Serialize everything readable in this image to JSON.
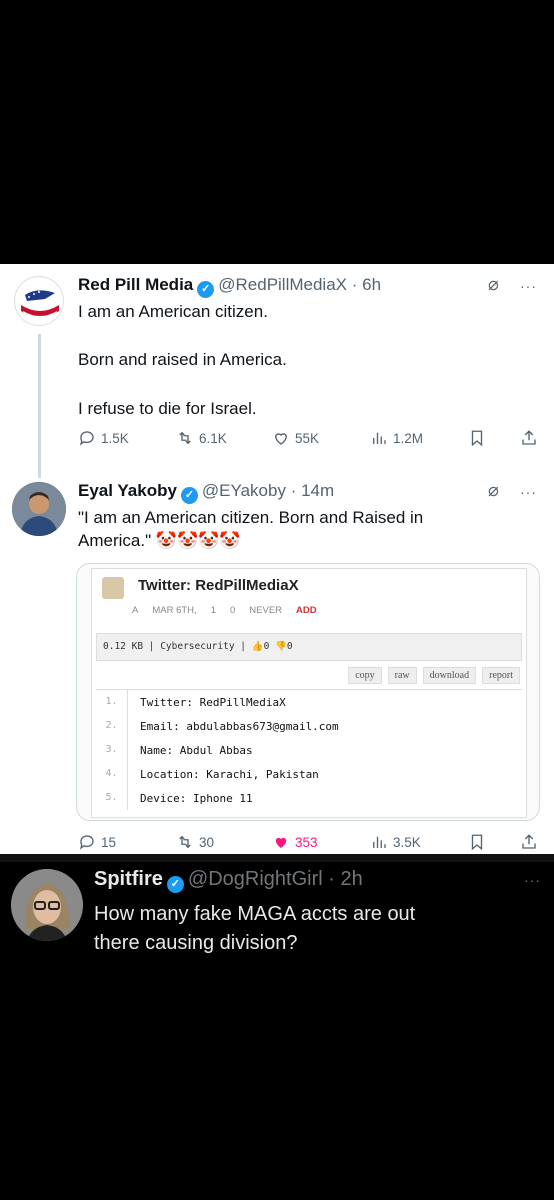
{
  "tweet1": {
    "name": "Red Pill Media",
    "handle": "@RedPillMediaX",
    "time": "6h",
    "lines": [
      "I am an American citizen.",
      "Born and raised in America.",
      "I refuse to die for Israel."
    ],
    "replies": "1.5K",
    "reposts": "6.1K",
    "likes": "55K",
    "views": "1.2M"
  },
  "tweet2": {
    "name": "Eyal Yakoby",
    "handle": "@EYakoby",
    "time": "14m",
    "line1": "\"I am an American citizen. Born and Raised in",
    "line2": "America.\"",
    "emoji": "🤡🤡🤡🤡",
    "replies": "15",
    "reposts": "30",
    "likes": "353",
    "views": "3.5K",
    "embed": {
      "title": "Twitter: RedPillMediaX",
      "meta": [
        "A",
        "MAR 6TH,",
        "1",
        "0",
        "NEVER",
        "ADD"
      ],
      "bar_text": "0.12 KB | Cybersecurity | ",
      "bar_up": "0",
      "bar_down": "0",
      "buttons": [
        "copy",
        "raw",
        "download",
        "report"
      ],
      "code": [
        {
          "n": "1.",
          "t": "Twitter: RedPillMediaX"
        },
        {
          "n": "2.",
          "t": "Email: abdulabbas673@gmail.com"
        },
        {
          "n": "3.",
          "t": "Name: Abdul Abbas"
        },
        {
          "n": "4.",
          "t": "Location: Karachi, Pakistan"
        },
        {
          "n": "5.",
          "t": "Device: Iphone 11"
        }
      ]
    }
  },
  "tweet3": {
    "name": "Spitfire",
    "handle": "@DogRightGirl",
    "time": "2h",
    "line1": "How many fake MAGA accts are out",
    "line2": "there causing division?"
  },
  "colors": {
    "verified": "#1d9bf0",
    "like_active": "#f91880",
    "dark_bg": "#000000"
  },
  "icons": [
    "reply-icon",
    "repost-icon",
    "like-icon",
    "views-icon",
    "bookmark-icon",
    "share-icon",
    "grok-icon",
    "more-icon",
    "verified-icon"
  ]
}
